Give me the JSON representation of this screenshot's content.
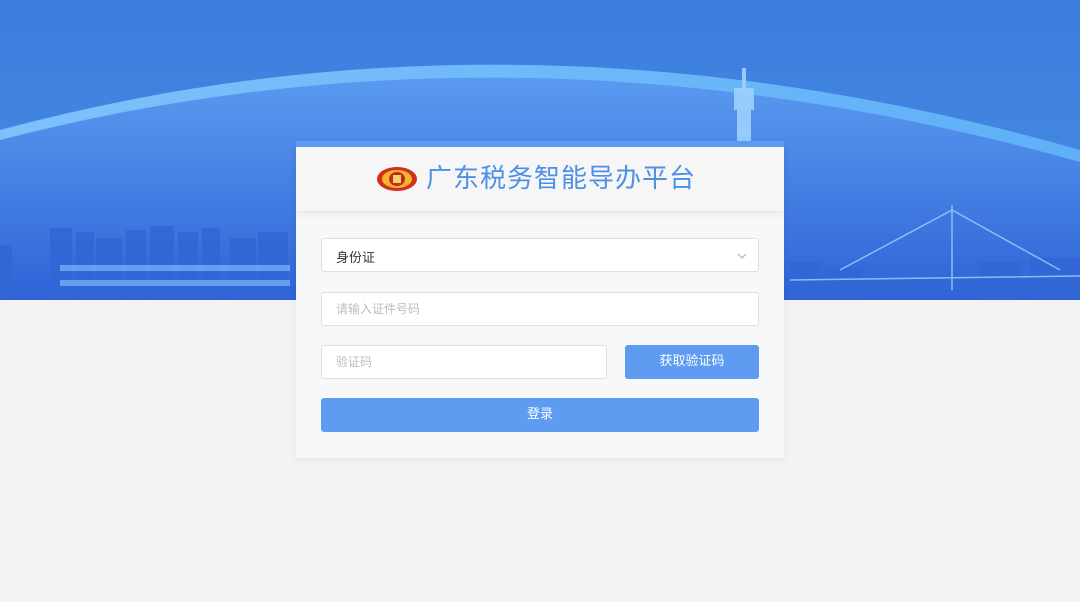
{
  "header": {
    "title": "广东税务智能导办平台",
    "emblem_icon": "tax-emblem-icon"
  },
  "form": {
    "id_type": {
      "selected": "身份证",
      "icon": "chevron-down-icon"
    },
    "id_number": {
      "placeholder": "请输入证件号码",
      "value": ""
    },
    "verification_code": {
      "placeholder": "验证码",
      "value": ""
    },
    "get_code_label": "获取验证码",
    "login_label": "登录"
  },
  "colors": {
    "primary": "#5d9cf0",
    "title": "#4e8fe8",
    "hero_sky": "#3f7fe0",
    "page_bg": "#f3f3f4"
  }
}
